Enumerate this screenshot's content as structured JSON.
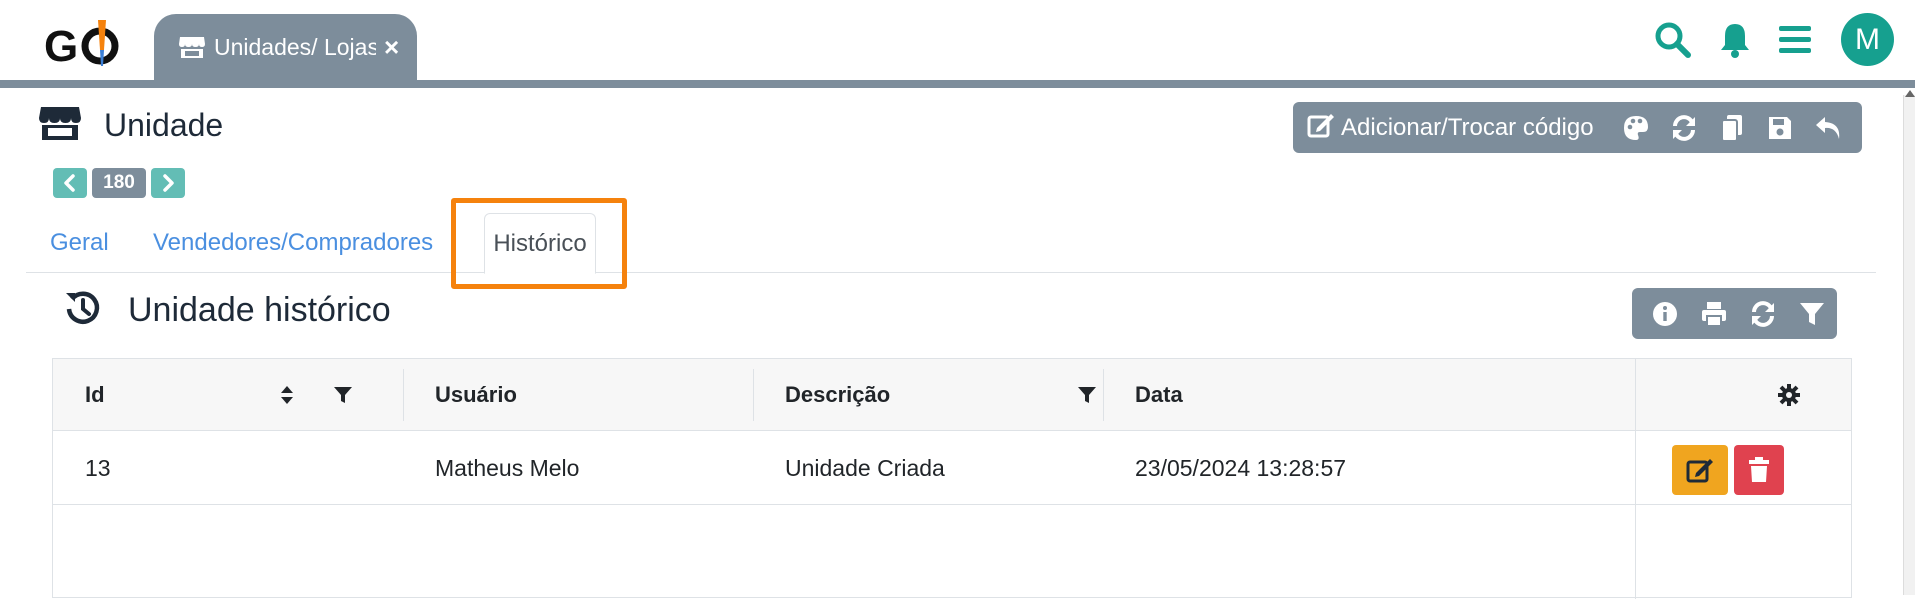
{
  "app": {
    "logo_text": "GO"
  },
  "open_tab": {
    "label": "Unidades/ Lojas",
    "close_symbol": "×",
    "icon": "store-icon"
  },
  "header_icons": [
    "search-icon",
    "bell-icon",
    "menu-icon"
  ],
  "user": {
    "avatar_initial": "M"
  },
  "colors": {
    "accent": "#16a08f",
    "toolbar": "#7d8d9b",
    "link": "#4a8fe0",
    "highlight": "#f5820d",
    "edit": "#f0a51f",
    "delete": "#e0424f"
  },
  "page": {
    "title": "Unidade",
    "icon": "store-icon"
  },
  "toolbar": {
    "add_change_code_label": "Adicionar/Trocar código",
    "icons": [
      "edit-icon",
      "palette-icon",
      "refresh-icon",
      "copy-icon",
      "save-icon",
      "undo-icon"
    ]
  },
  "pager": {
    "current": "180",
    "prev_icon": "chevron-left-icon",
    "next_icon": "chevron-right-icon"
  },
  "tabs": [
    {
      "label": "Geral",
      "active": false
    },
    {
      "label": "Vendedores/Compradores",
      "active": false
    },
    {
      "label": "Histórico",
      "active": true
    }
  ],
  "section": {
    "title": "Unidade histórico",
    "icon": "history-icon",
    "toolbar_icons": [
      "info-icon",
      "print-icon",
      "refresh-icon",
      "filter-icon"
    ]
  },
  "table": {
    "columns": [
      {
        "label": "Id",
        "sortable": true,
        "filterable": true
      },
      {
        "label": "Usuário",
        "sortable": false,
        "filterable": false
      },
      {
        "label": "Descrição",
        "sortable": false,
        "filterable": true
      },
      {
        "label": "Data",
        "sortable": false,
        "filterable": false
      }
    ],
    "settings_icon": "gear-icon",
    "rows": [
      {
        "id": "13",
        "usuario": "Matheus Melo",
        "descricao": "Unidade Criada",
        "data": "23/05/2024 13:28:57"
      }
    ]
  }
}
